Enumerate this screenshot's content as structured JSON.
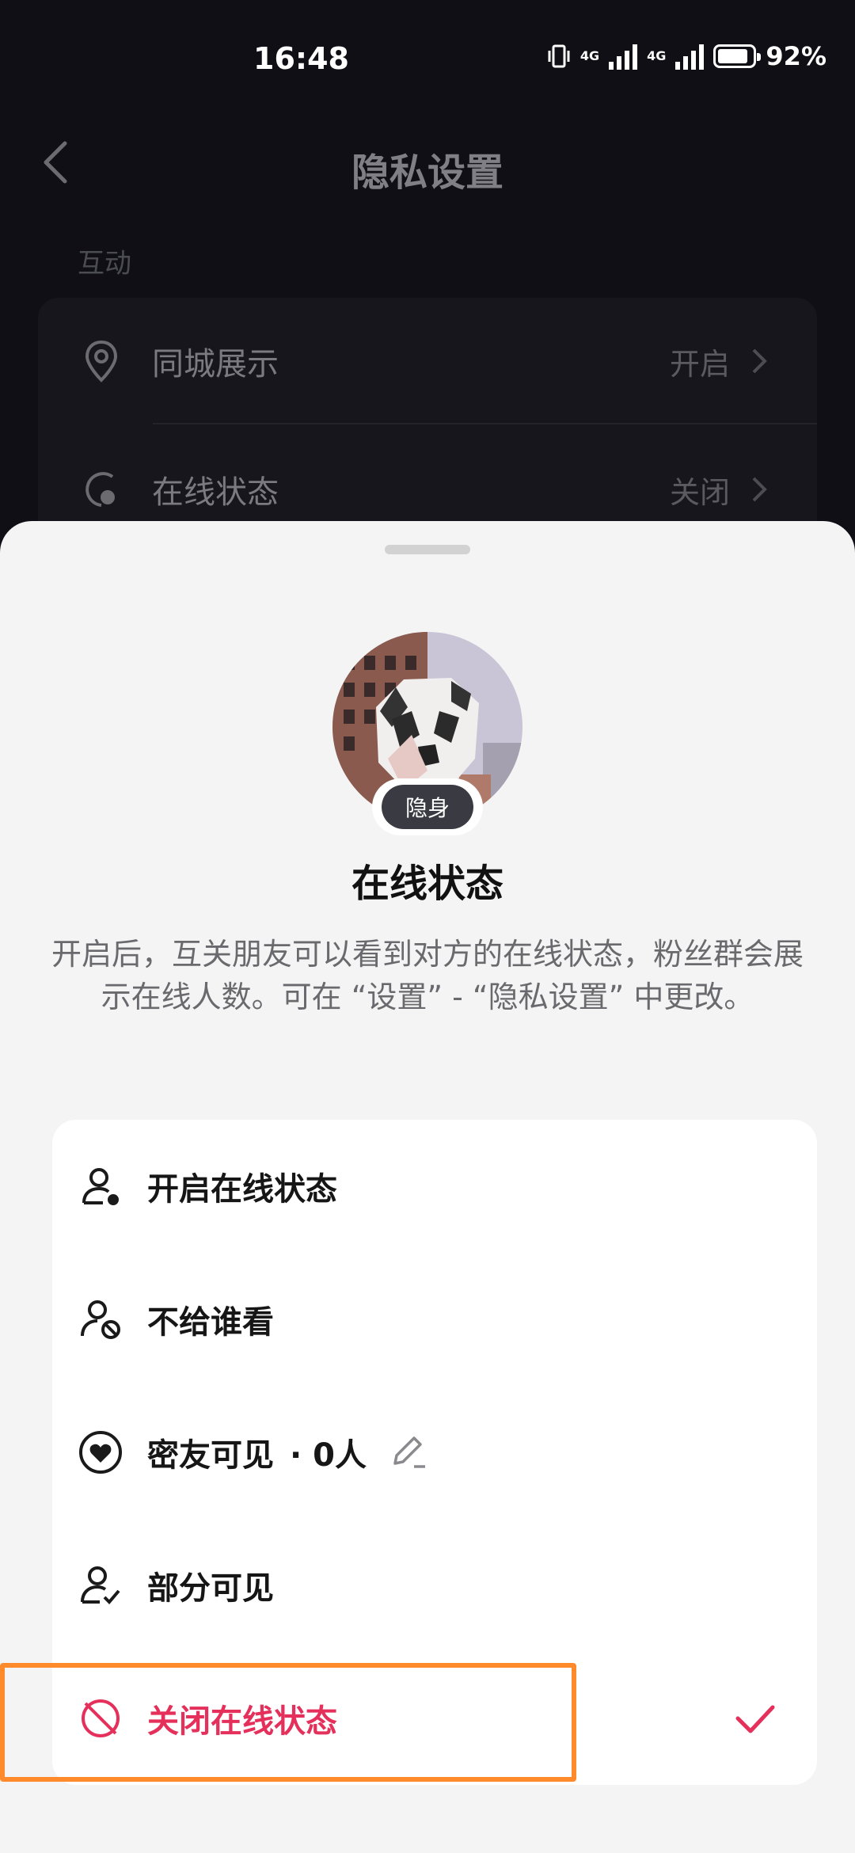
{
  "status_bar": {
    "time": "16:48",
    "network_1": "4G",
    "network_2": "4G",
    "battery": "92%",
    "battery_level": 0.92
  },
  "header": {
    "title": "隐私设置"
  },
  "section": {
    "label": "互动"
  },
  "settings": [
    {
      "label": "同城展示",
      "value": "开启",
      "icon": "location-pin-icon"
    },
    {
      "label": "在线状态",
      "value": "关闭",
      "icon": "online-status-icon"
    }
  ],
  "sheet": {
    "badge": "隐身",
    "title": "在线状态",
    "description": "开启后，互关朋友可以看到对方的在线状态，粉丝群会展示在线人数。可在 “设置” - “隐私设置” 中更改。",
    "options": [
      {
        "label": "开启在线状态",
        "icon": "user-online-icon"
      },
      {
        "label": "不给谁看",
        "icon": "user-block-icon"
      },
      {
        "label": "密友可见",
        "extra": "· 0人",
        "icon": "heart-circle-icon"
      },
      {
        "label": "部分可见",
        "icon": "user-check-icon"
      },
      {
        "label": "关闭在线状态",
        "icon": "online-off-icon",
        "selected": true
      }
    ]
  },
  "colors": {
    "accent": "#e4305a",
    "highlight_border": "#ff8a2b",
    "sheet_bg": "#f4f4f4"
  }
}
